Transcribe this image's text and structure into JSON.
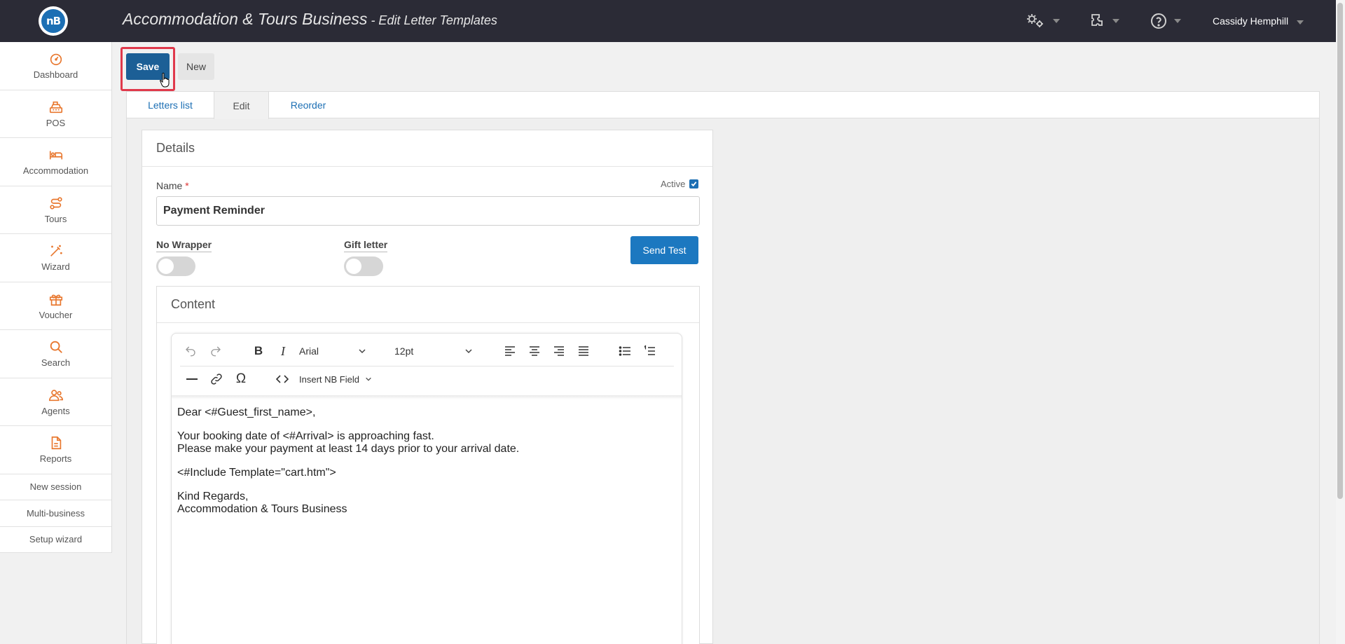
{
  "app": {
    "business_name": "Accommodation & Tours Business",
    "page_title": " - Edit Letter Templates",
    "logo_text": "nB",
    "user_name": "Cassidy Hemphill"
  },
  "sidebar": {
    "items": [
      {
        "label": "Dashboard",
        "icon": "dashboard-icon"
      },
      {
        "label": "POS",
        "icon": "cash-register-icon"
      },
      {
        "label": "Accommodation",
        "icon": "bed-icon"
      },
      {
        "label": "Tours",
        "icon": "route-icon"
      },
      {
        "label": "Wizard",
        "icon": "magic-wand-icon"
      },
      {
        "label": "Voucher",
        "icon": "gift-icon"
      },
      {
        "label": "Search",
        "icon": "search-icon"
      },
      {
        "label": "Agents",
        "icon": "users-icon"
      },
      {
        "label": "Reports",
        "icon": "file-icon"
      }
    ],
    "links": [
      "New session",
      "Multi-business",
      "Setup wizard"
    ]
  },
  "toolbar": {
    "save_label": "Save",
    "new_label": "New"
  },
  "tabs": [
    {
      "label": "Letters list",
      "active": false
    },
    {
      "label": "Edit",
      "active": true
    },
    {
      "label": "Reorder",
      "active": false
    }
  ],
  "details": {
    "heading": "Details",
    "name_label": "Name",
    "required_mark": "*",
    "active_label": "Active",
    "active_checked": true,
    "name_value": "Payment Reminder",
    "no_wrapper_label": "No Wrapper",
    "no_wrapper_on": false,
    "gift_letter_label": "Gift letter",
    "gift_letter_on": false,
    "send_test_label": "Send Test"
  },
  "content": {
    "heading": "Content",
    "font_family": "Arial",
    "font_size": "12pt",
    "insert_field_label": "Insert NB Field",
    "body_lines": [
      "Dear <#Guest_first_name>,",
      "Your booking date of <#Arrival> is approaching fast.\nPlease make your payment at least 14 days prior to your arrival date.",
      "<#Include Template=\"cart.htm\">",
      "Kind Regards,\nAccommodation & Tours Business"
    ]
  },
  "colors": {
    "topbar": "#2b2b36",
    "primary": "#1c5f96",
    "accent_orange": "#e8772e",
    "highlight": "#e0394b"
  }
}
